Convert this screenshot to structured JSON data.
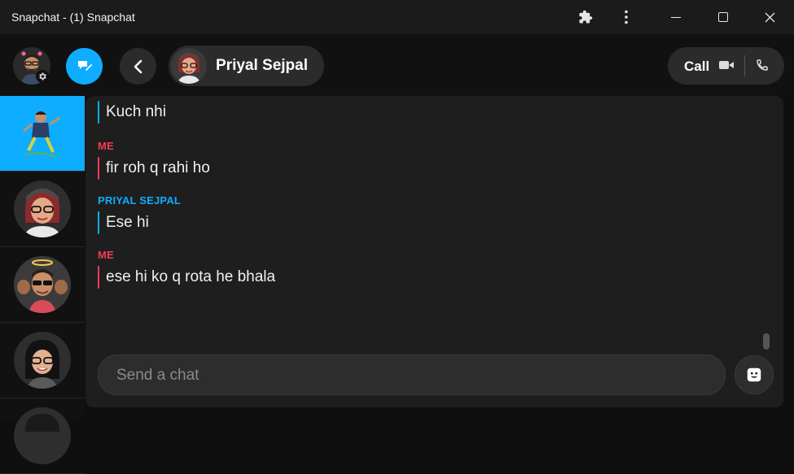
{
  "window": {
    "title": "Snapchat - (1) Snapchat",
    "icons": [
      "puzzle-icon",
      "more-vertical-icon",
      "minimize-icon",
      "maximize-icon",
      "close-icon"
    ]
  },
  "header": {
    "contact_name": "Priyal Sejpal",
    "call_label": "Call",
    "icons": [
      "new-chat-icon",
      "back-icon",
      "video-icon",
      "phone-icon",
      "gear-icon"
    ]
  },
  "sidebar": {
    "conversations": [
      {
        "avatar": "bitmoji-dancing",
        "active": true
      },
      {
        "avatar": "bitmoji-red-hair-glasses",
        "active": false
      },
      {
        "avatar": "bitmoji-halo-sunglasses",
        "active": false
      },
      {
        "avatar": "bitmoji-dark-hair-glasses",
        "active": false
      }
    ]
  },
  "chat": {
    "messages": [
      {
        "sender": "",
        "text": "Kuch nhi",
        "from": "them"
      },
      {
        "sender": "ME",
        "text": "fir roh q rahi ho",
        "from": "me"
      },
      {
        "sender": "PRIYAL SEJPAL",
        "text": "Ese hi",
        "from": "them"
      },
      {
        "sender": "ME",
        "text": "ese hi ko q rota he bhala",
        "from": "me"
      }
    ],
    "input_placeholder": "Send a chat"
  },
  "colors": {
    "accent": "#0fadff",
    "me": "#f23c57",
    "background": "#111111",
    "panel": "#1e1e1e"
  }
}
